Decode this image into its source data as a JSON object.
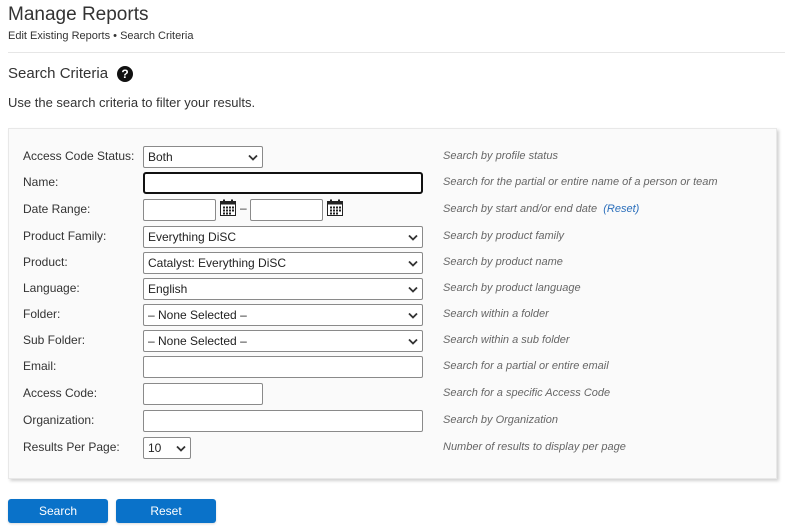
{
  "header": {
    "title": "Manage Reports",
    "breadcrumb": [
      "Edit Existing Reports",
      "•",
      "Search Criteria"
    ]
  },
  "section": {
    "title": "Search Criteria",
    "help_icon": "question-circle-icon",
    "help_glyph": "?",
    "description": "Use the search criteria to filter your results."
  },
  "form": {
    "access_code_status": {
      "label": "Access Code Status:",
      "value": "Both",
      "hint": "Search by profile status"
    },
    "name": {
      "label": "Name:",
      "value": "",
      "placeholder": "",
      "hint": "Search for the partial or entire name of a person or team"
    },
    "date_range": {
      "label": "Date Range:",
      "start": "",
      "end": "",
      "separator": "–",
      "hint": "Search by start and/or end date",
      "reset_link": "(Reset)",
      "calendar_icon": "calendar-icon"
    },
    "product_family": {
      "label": "Product Family:",
      "value": "Everything DiSC",
      "hint": "Search by product family"
    },
    "product": {
      "label": "Product:",
      "value": "Catalyst: Everything DiSC",
      "hint": "Search by product name"
    },
    "language": {
      "label": "Language:",
      "value": "English",
      "hint": "Search by product language"
    },
    "folder": {
      "label": "Folder:",
      "value": "– None Selected –",
      "hint": "Search within a folder"
    },
    "sub_folder": {
      "label": "Sub Folder:",
      "value": "– None Selected –",
      "hint": "Search within a sub folder"
    },
    "email": {
      "label": "Email:",
      "value": "",
      "hint": "Search for a partial or entire email"
    },
    "access_code": {
      "label": "Access Code:",
      "value": "",
      "hint": "Search for a specific Access Code"
    },
    "organization": {
      "label": "Organization:",
      "value": "",
      "hint": "Search by Organization"
    },
    "results_per_page": {
      "label": "Results Per Page:",
      "value": "10",
      "hint": "Number of results to display per page"
    }
  },
  "buttons": {
    "search": "Search",
    "reset": "Reset"
  },
  "colors": {
    "primary_button": "#0a72c9",
    "link": "#2a6ebb"
  }
}
